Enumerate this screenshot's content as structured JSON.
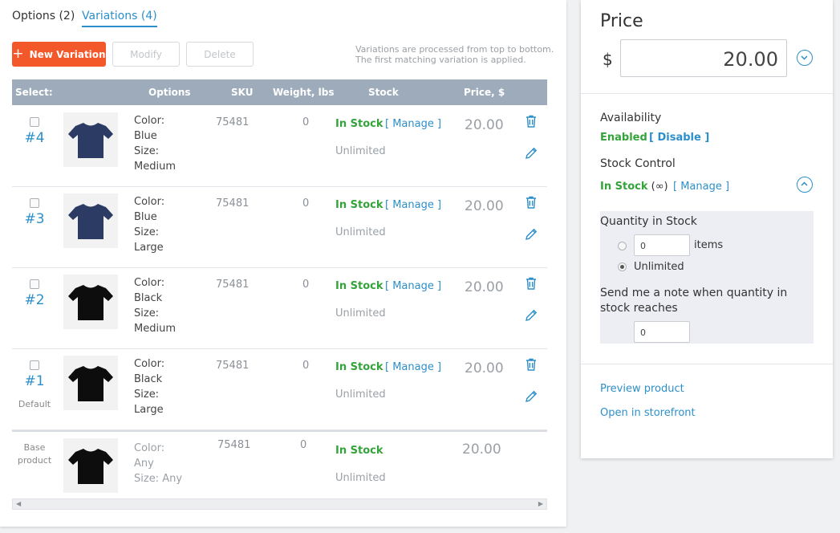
{
  "tabs": [
    {
      "label": "Options (2)",
      "active": false
    },
    {
      "label": "Variations (4)",
      "active": true
    }
  ],
  "toolbar": {
    "new_label": "New Variation",
    "modify_label": "Modify",
    "delete_label": "Delete",
    "hint_line1": "Variations are processed from top to bottom.",
    "hint_line2": "The first matching variation is applied."
  },
  "table": {
    "headers": {
      "select": "Select:",
      "options": "Options",
      "sku": "SKU",
      "weight": "Weight, lbs",
      "stock": "Stock",
      "price": "Price, $"
    },
    "rows": [
      {
        "number": "#4",
        "default_label": "",
        "color_label": "Color:",
        "color": "Blue",
        "size_label": "Size:",
        "size": "Medium",
        "sku": "75481",
        "weight": "0",
        "stock": "In Stock",
        "manage": "[ Manage ]",
        "qty": "Unlimited",
        "price": "20.00",
        "shirt_color": "#2b3b63"
      },
      {
        "number": "#3",
        "default_label": "",
        "color_label": "Color:",
        "color": "Blue",
        "size_label": "Size:",
        "size": "Large",
        "sku": "75481",
        "weight": "0",
        "stock": "In Stock",
        "manage": "[ Manage ]",
        "qty": "Unlimited",
        "price": "20.00",
        "shirt_color": "#2b3b63"
      },
      {
        "number": "#2",
        "default_label": "",
        "color_label": "Color:",
        "color": "Black",
        "size_label": "Size:",
        "size": "Medium",
        "sku": "75481",
        "weight": "0",
        "stock": "In Stock",
        "manage": "[ Manage ]",
        "qty": "Unlimited",
        "price": "20.00",
        "shirt_color": "#0d0d0d"
      },
      {
        "number": "#1",
        "default_label": "Default",
        "color_label": "Color:",
        "color": "Black",
        "size_label": "Size:",
        "size": "Large",
        "sku": "75481",
        "weight": "0",
        "stock": "In Stock",
        "manage": "[ Manage ]",
        "qty": "Unlimited",
        "price": "20.00",
        "shirt_color": "#0d0d0d"
      }
    ],
    "base": {
      "label_line1": "Base",
      "label_line2": "product",
      "color_label": "Color:",
      "color": "Any",
      "size_text": "Size: Any",
      "sku": "75481",
      "weight": "0",
      "stock": "In Stock",
      "qty": "Unlimited",
      "price": "20.00",
      "shirt_color": "#0d0d0d"
    }
  },
  "sidebar": {
    "price_title": "Price",
    "currency": "$",
    "price_value": "20.00",
    "availability_label": "Availability",
    "availability_value": "Enabled",
    "availability_link": "[ Disable ]",
    "stock_control_label": "Stock Control",
    "stock_control_value": "In Stock",
    "stock_control_inf": "(∞)",
    "stock_control_link": "[ Manage ]",
    "quantity_label": "Quantity in Stock",
    "quantity_value": "0",
    "items_label": "items",
    "unlimited_label": "Unlimited",
    "note_label": "Send me a note when quantity in stock reaches",
    "note_value": "0",
    "preview_link": "Preview product",
    "storefront_link": "Open in storefront"
  },
  "colors": {
    "accent": "#2d8fc9",
    "success": "#35a33b",
    "primary_button": "#f3582a",
    "header_bg": "#9eabba"
  }
}
